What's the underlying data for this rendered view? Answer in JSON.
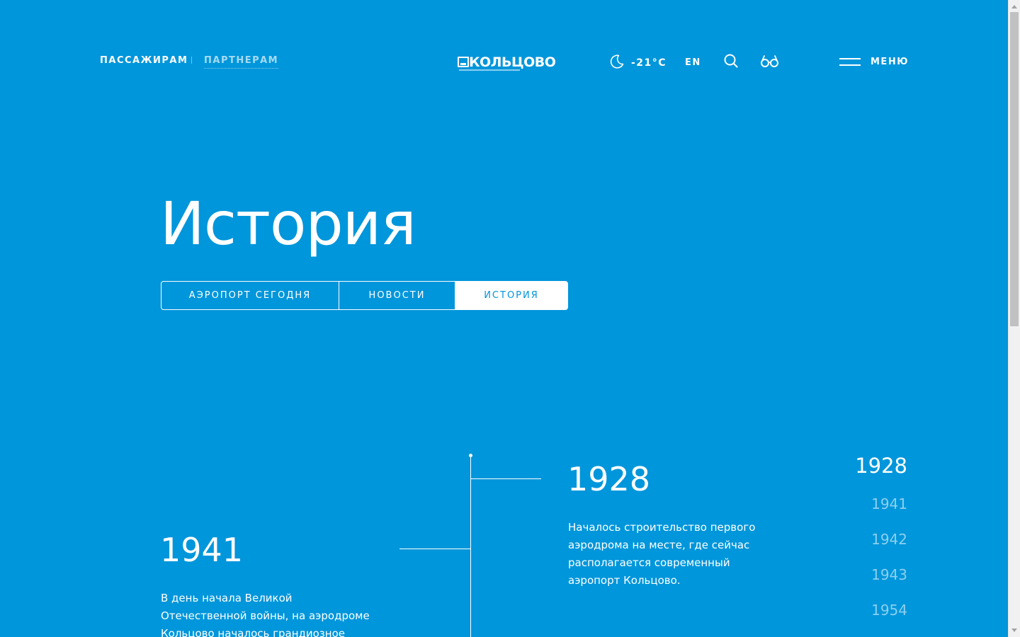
{
  "header": {
    "nav_passengers": "ПАССАЖИРАМ",
    "nav_partners": "ПАРТНЕРАМ",
    "logo_text": "КОЛЬЦОВО",
    "weather_icon": "moon-icon",
    "temperature": "-21°C",
    "language": "EN",
    "search_icon": "search-icon",
    "accessibility_icon": "glasses-icon",
    "menu_label": "МЕНЮ"
  },
  "page_title": "История",
  "tabs": [
    {
      "label": "АЭРОПОРТ СЕГОДНЯ",
      "active": false
    },
    {
      "label": "НОВОСТИ",
      "active": false
    },
    {
      "label": "ИСТОРИЯ",
      "active": true
    }
  ],
  "timeline": {
    "events": [
      {
        "year": "1928",
        "text": "Началось строительство первого аэродрома на месте, где сейчас располагается современный аэропорт Кольцово."
      },
      {
        "year": "1941",
        "text": "В день начала Великой Отечественной войны, на аэродроме Кольцово началось грандиозное строительство"
      }
    ],
    "year_nav": [
      "1928",
      "1941",
      "1942",
      "1943",
      "1954"
    ],
    "active_year": "1928"
  },
  "colors": {
    "background": "#0096db",
    "text": "#ffffff"
  }
}
